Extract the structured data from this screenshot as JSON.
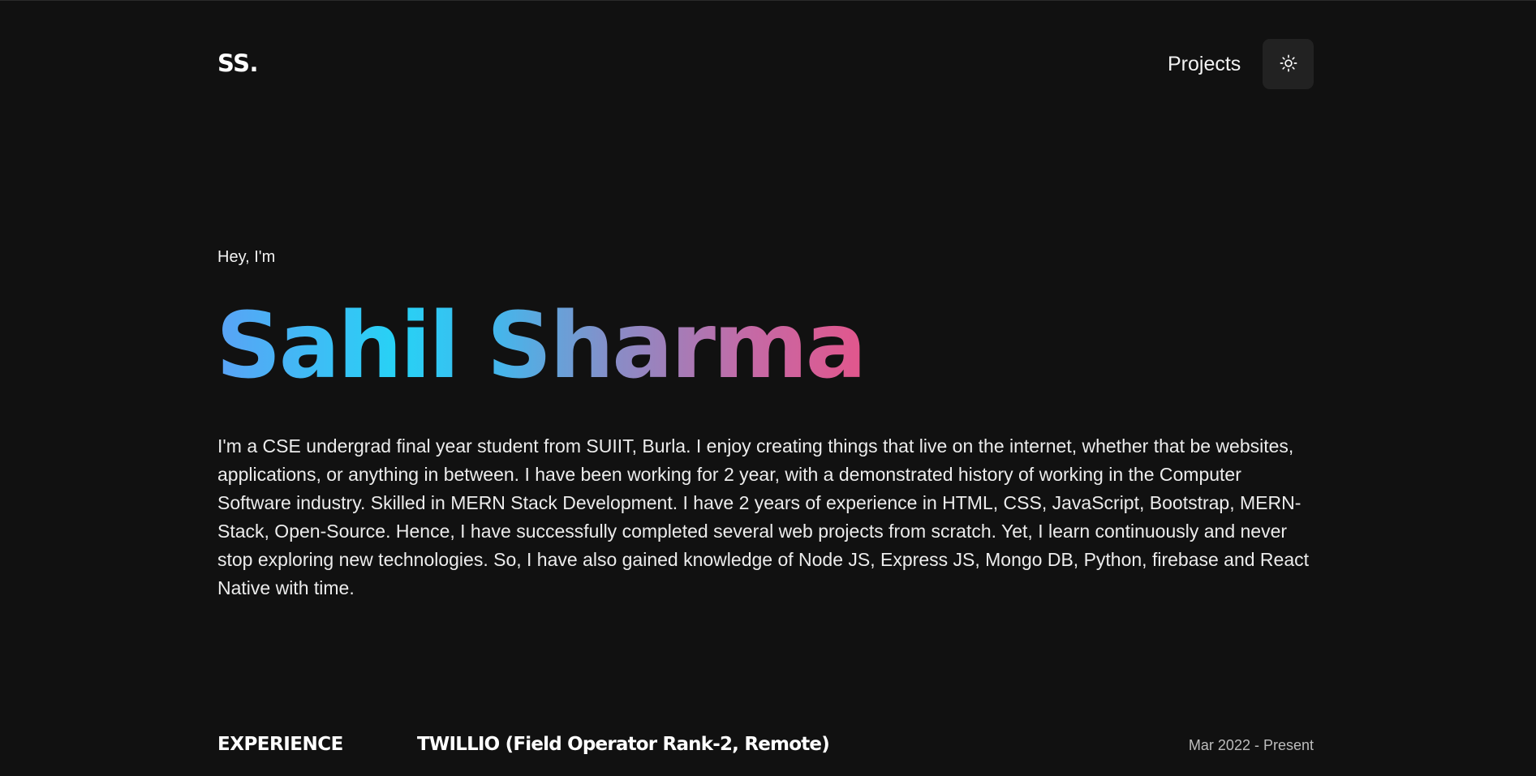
{
  "header": {
    "logo": "SS.",
    "nav_projects": "Projects",
    "theme_icon": "sun-icon"
  },
  "hero": {
    "greeting": "Hey, I'm",
    "name": "Sahil Sharma",
    "gradient_colors": [
      "#5aa2f5",
      "#27d2f5",
      "#3fb9ee",
      "#8a8cc6",
      "#c46aa6",
      "#e2568c"
    ],
    "bio": "I'm a CSE undergrad final year student from SUIIT, Burla. I enjoy creating things that live on the internet, whether that be websites, applications, or anything in between. I have been working for 2 year, with a demonstrated history of working in the Computer Software industry. Skilled in MERN Stack Development. I have 2 years of experience in HTML, CSS, JavaScript, Bootstrap, MERN-Stack, Open-Source. Hence, I have successfully completed several web projects from scratch. Yet, I learn continuously and never stop exploring new technologies. So, I have also gained knowledge of Node JS, Express JS, Mongo DB, Python, firebase and React Native with time."
  },
  "experience": {
    "section_label": "EXPERIENCE",
    "items": [
      {
        "title": "TWILLIO (Field Operator Rank-2, Remote)",
        "date": "Mar 2022 - Present"
      }
    ]
  },
  "colors": {
    "background": "#111111",
    "toggle_background": "#222222",
    "text": "#ffffff",
    "muted_text": "#bdbdbd"
  }
}
